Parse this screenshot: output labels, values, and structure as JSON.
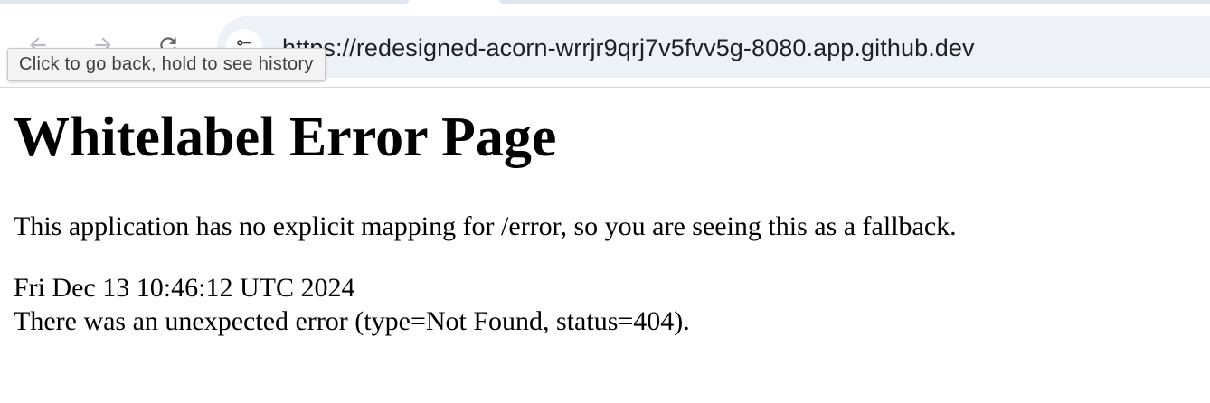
{
  "browser": {
    "url": "https://redesigned-acorn-wrrjr9qrj7v5fvv5g-8080.app.github.dev",
    "tooltip": "Click to go back, hold to see history",
    "icons": {
      "back": "arrow-left-icon",
      "forward": "arrow-right-icon",
      "reload": "reload-icon",
      "site_info": "tune-icon"
    }
  },
  "page": {
    "title": "Whitelabel Error Page",
    "message": "This application has no explicit mapping for /error, so you are seeing this as a fallback.",
    "timestamp": "Fri Dec 13 10:46:12 UTC 2024",
    "error_detail": "There was an unexpected error (type=Not Found, status=404)."
  },
  "colors": {
    "omnibox_bg": "#edf1f8",
    "tab_bg": "#dfe6f2",
    "tooltip_bg": "#f3f3f3"
  }
}
